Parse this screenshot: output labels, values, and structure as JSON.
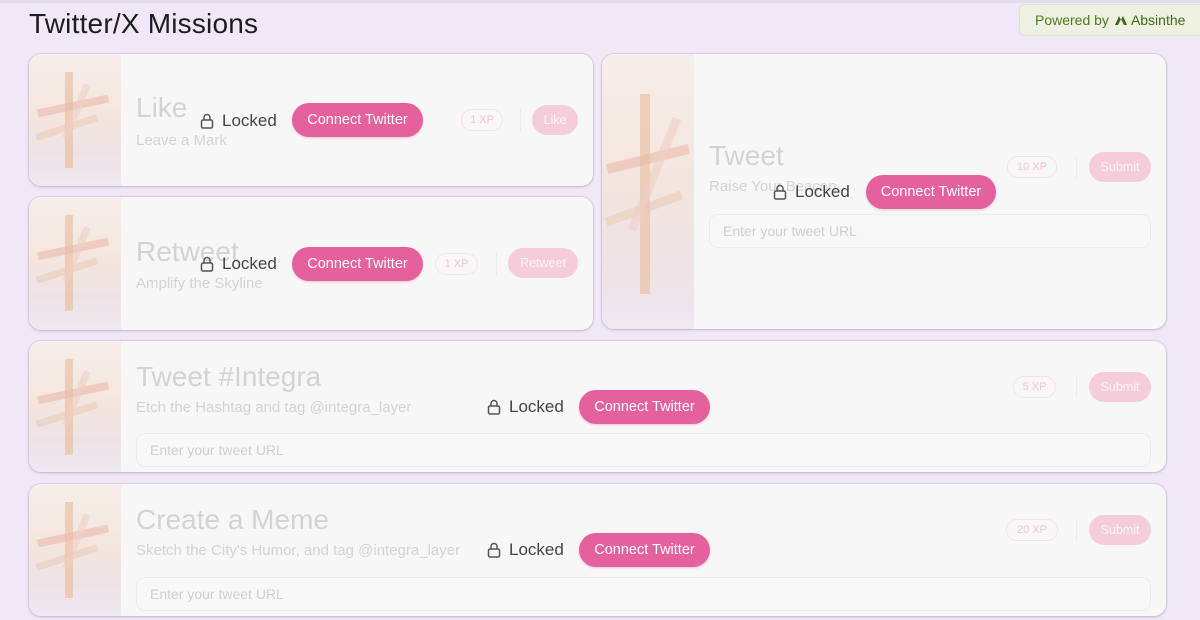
{
  "page": {
    "title": "Twitter/X Missions",
    "powered_by": "Powered by",
    "brand": "Absinthe",
    "accent": "#e4619d"
  },
  "missions": [
    {
      "title": "Like",
      "subtitle": "Leave a Mark",
      "xp": "1 XP",
      "action": "Like",
      "locked": "Locked",
      "connect": "Connect Twitter"
    },
    {
      "title": "Retweet",
      "subtitle": "Amplify the Skyline",
      "xp": "1 XP",
      "action": "Retweet",
      "locked": "Locked",
      "connect": "Connect Twitter"
    },
    {
      "title": "Tweet",
      "subtitle": "Raise Your Beacon",
      "xp": "10 XP",
      "action": "Submit",
      "locked": "Locked",
      "connect": "Connect Twitter",
      "url_placeholder": "Enter your tweet URL"
    },
    {
      "title": "Tweet #Integra",
      "subtitle": "Etch the Hashtag and tag @integra_layer",
      "xp": "5 XP",
      "action": "Submit",
      "locked": "Locked",
      "connect": "Connect Twitter",
      "url_placeholder": "Enter your tweet URL"
    },
    {
      "title": "Create a Meme",
      "subtitle": "Sketch the City's Humor, and tag @integra_layer",
      "xp": "20 XP",
      "action": "Submit",
      "locked": "Locked",
      "connect": "Connect Twitter",
      "url_placeholder": "Enter your tweet URL"
    }
  ],
  "icons": {
    "lock": "lock-icon",
    "brand_logo": "absinthe-logo-icon",
    "thumbnail": "mission-thumbnail"
  }
}
